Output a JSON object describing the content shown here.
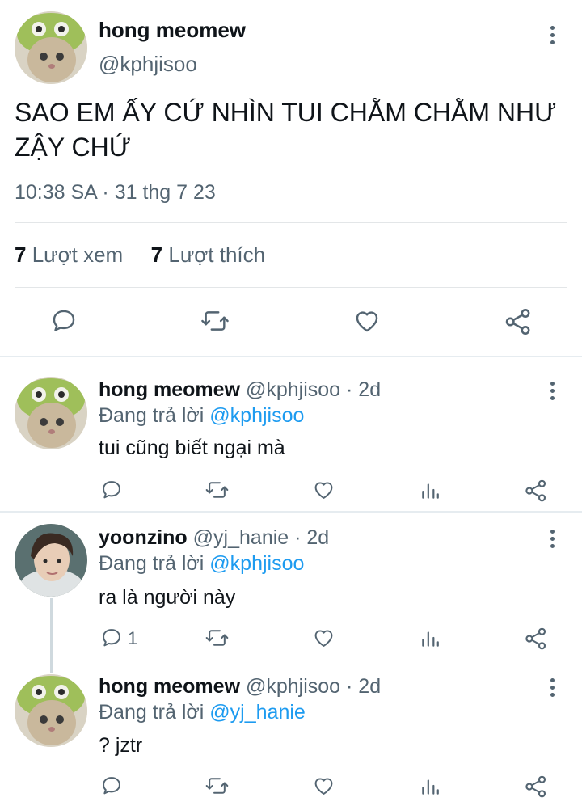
{
  "main_tweet": {
    "author_name": "hong meomew",
    "author_handle": "@kphjisoo",
    "text": "SAO EM ẤY CỨ NHÌN TUI CHẰM CHẰM NHƯ ZẬY CHỨ",
    "timestamp": "10:38 SA · 31 thg 7 23",
    "views_count": "7",
    "views_label": "Lượt xem",
    "likes_count": "7",
    "likes_label": "Lượt thích",
    "actions": [
      "reply-icon",
      "retweet-icon",
      "like-icon",
      "share-icon"
    ]
  },
  "replies": [
    {
      "author_name": "hong meomew",
      "author_handle": "@kphjisoo · 2d",
      "replying_prefix": "Đang trả lời",
      "replying_to": "@kphjisoo",
      "text": "tui cũng biết ngại mà",
      "reply_count": ""
    },
    {
      "author_name": "yoonzino",
      "author_handle": "@yj_hanie · 2d",
      "replying_prefix": "Đang trả lời",
      "replying_to": "@kphjisoo",
      "text": "ra là người này",
      "reply_count": "1"
    },
    {
      "author_name": "hong meomew",
      "author_handle": "@kphjisoo · 2d",
      "replying_prefix": "Đang trả lời",
      "replying_to": "@yj_hanie",
      "text": "? jztr",
      "reply_count": ""
    }
  ],
  "colors": {
    "text_primary": "#0f1419",
    "text_secondary": "#536471",
    "link": "#1d9bf0",
    "divider": "#e6ecf0"
  }
}
